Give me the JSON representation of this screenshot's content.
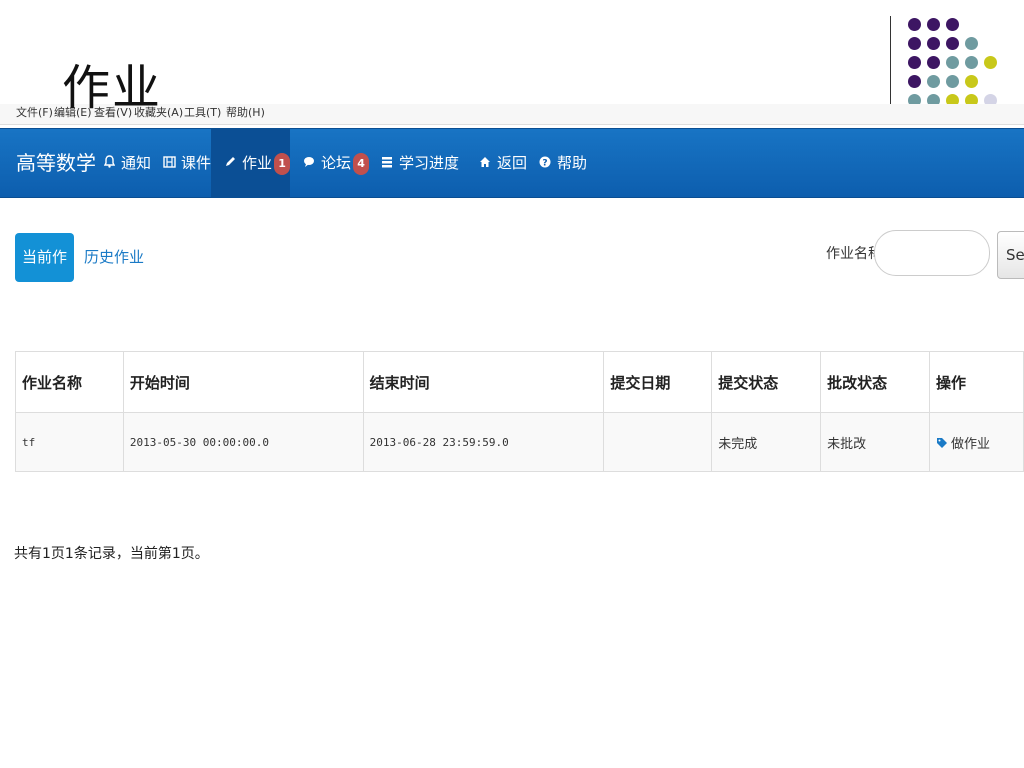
{
  "slide": {
    "title": "作业"
  },
  "menu_strip": [
    "文件(F)",
    "编辑(E)",
    "查看(V)",
    "收藏夹(A)",
    "工具(T)",
    "帮助(H)"
  ],
  "navbar": {
    "brand": "高等数学",
    "items": [
      {
        "label": "通知",
        "icon": "bell-icon"
      },
      {
        "label": "课件",
        "icon": "film-icon"
      },
      {
        "label": "作业",
        "icon": "pencil-icon",
        "badge": "1",
        "active": true
      },
      {
        "label": "论坛",
        "icon": "comment-icon",
        "badge": "4"
      },
      {
        "label": "学习进度",
        "icon": "tasks-icon"
      },
      {
        "label": "返回",
        "icon": "home-icon"
      },
      {
        "label": "帮助",
        "icon": "question-icon"
      }
    ]
  },
  "tabs": {
    "current": "当前作业",
    "history": "历史作业"
  },
  "search": {
    "label": "作业名称",
    "value": "",
    "button": "Search"
  },
  "table": {
    "headers": [
      "作业名称",
      "开始时间",
      "结束时间",
      "提交日期",
      "提交状态",
      "批改状态",
      "操作"
    ],
    "rows": [
      {
        "name": "tf",
        "start": "2013-05-30 00:00:00.0",
        "end": "2013-06-28 23:59:59.0",
        "submit_date": "",
        "submit_status": "未完成",
        "grade_status": "未批改",
        "action": "做作业"
      }
    ]
  },
  "footer": "共有1页1条记录，当前第1页。",
  "colors": {
    "navbar": "#0d5eae",
    "accent": "#1391d6",
    "badge": "#c0504d",
    "incomplete": "#d40000"
  }
}
